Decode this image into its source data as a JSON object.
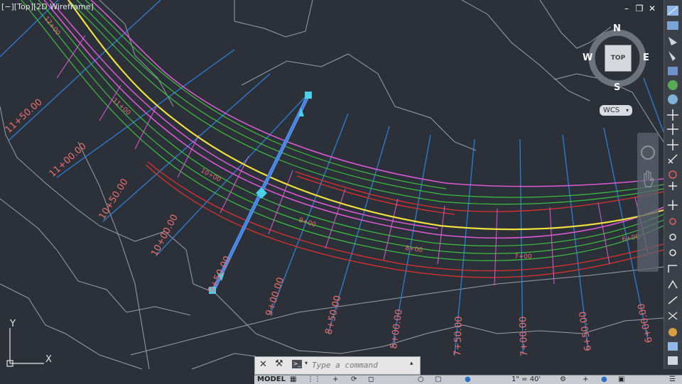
{
  "viewport": {
    "label": "[−][Top][2D Wireframe]",
    "ucs_x": "X",
    "ucs_y": "Y"
  },
  "window_controls": {
    "minimize": "–",
    "restore": "❐",
    "close": "✕"
  },
  "viewcube": {
    "top_face": "TOP",
    "north": "N",
    "south": "S",
    "east": "E",
    "west": "W",
    "wcs_label": "WCS"
  },
  "stations": [
    {
      "id": "s11p50",
      "text": "11+50.00"
    },
    {
      "id": "s11p00",
      "text": "11+00.00"
    },
    {
      "id": "s10p50",
      "text": "10+50.00"
    },
    {
      "id": "s10p00",
      "text": "10+00.00"
    },
    {
      "id": "s9p50",
      "text": "9+50.00"
    },
    {
      "id": "s9p00",
      "text": "9+00.00"
    },
    {
      "id": "s8p50",
      "text": "8+50.00"
    },
    {
      "id": "s8p00",
      "text": "8+00.00"
    },
    {
      "id": "s7p50",
      "text": "7+50.00"
    },
    {
      "id": "s7p00",
      "text": "7+00.00"
    },
    {
      "id": "s6p50",
      "text": "6+50.00"
    },
    {
      "id": "s6p00",
      "text": "6+00.00"
    }
  ],
  "alignment_labels": [
    {
      "id": "a12",
      "text": "12+00"
    },
    {
      "id": "a11",
      "text": "11+00"
    },
    {
      "id": "a10",
      "text": "10+00"
    },
    {
      "id": "a9",
      "text": "9+00"
    },
    {
      "id": "a8",
      "text": "8+00"
    },
    {
      "id": "a7",
      "text": "7+00"
    },
    {
      "id": "a6",
      "text": "6+00"
    }
  ],
  "colors": {
    "background": "#2b3039",
    "sample_lines": "#2e7fd6",
    "alignment": "#f0e040",
    "edges": "#e05ad8",
    "corridor": "#3fbf3f",
    "daylight": "#e03030",
    "terrain": "#9aa0a8",
    "station_text": "#f07070",
    "grip": "#4ad0e8"
  },
  "command_line": {
    "placeholder": "Type a command"
  },
  "status_bar": {
    "model_tab": "MODEL",
    "scale": "1\" = 40'"
  }
}
